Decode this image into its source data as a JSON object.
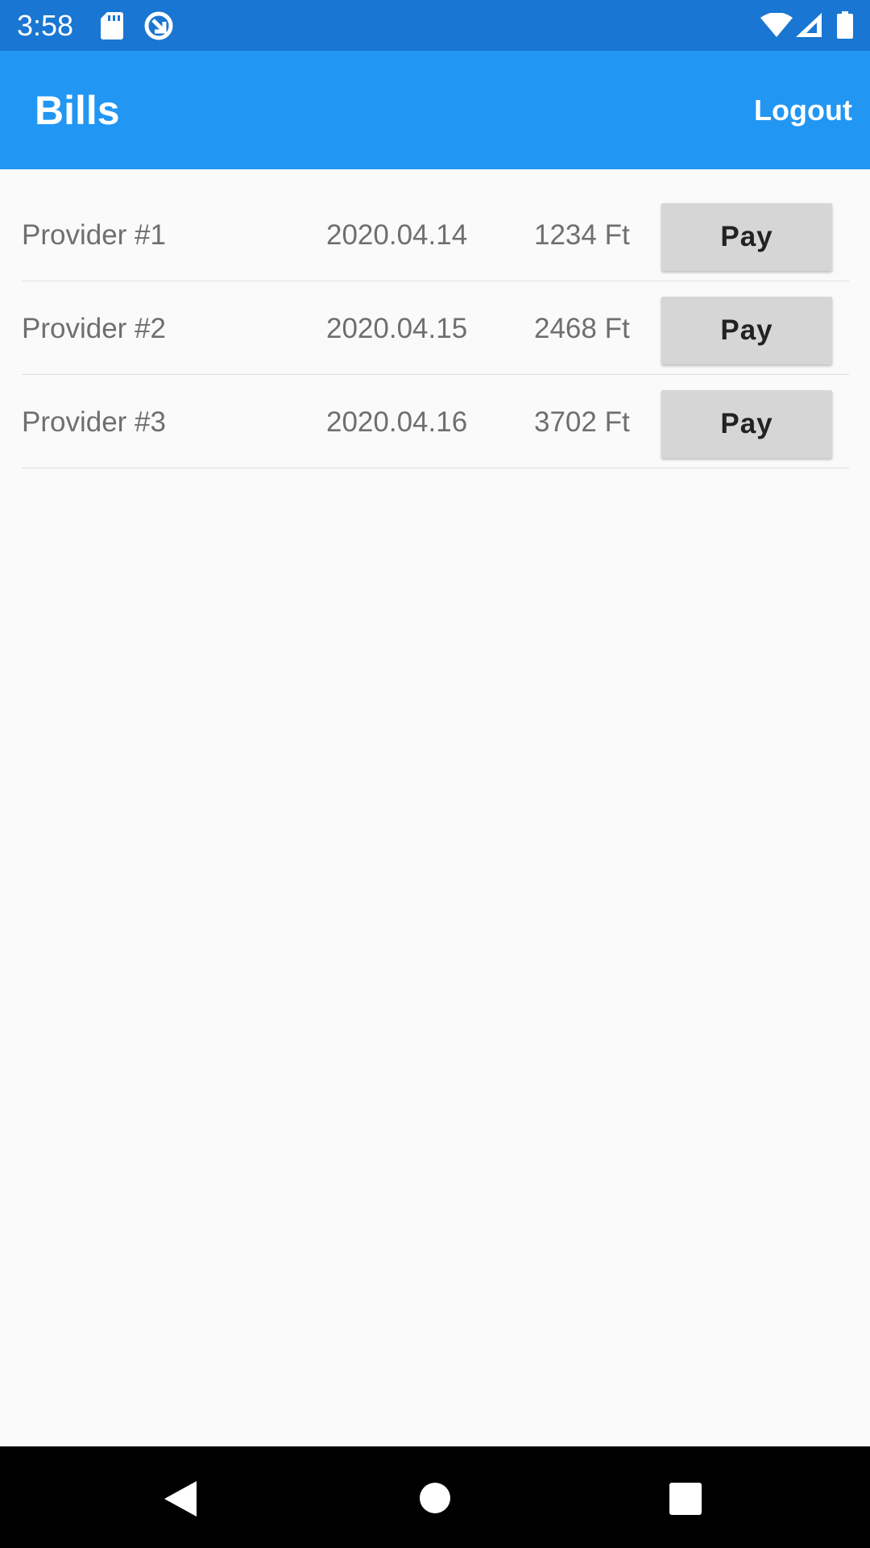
{
  "status_bar": {
    "time": "3:58",
    "left_icons": [
      "sd-card-icon",
      "data-saver-icon"
    ],
    "right_icons": [
      "wifi-icon",
      "cell-signal-icon",
      "battery-icon"
    ]
  },
  "app_bar": {
    "title": "Bills",
    "logout_label": "Logout",
    "color": "#2196f3"
  },
  "bills": [
    {
      "provider": "Provider #1",
      "date": "2020.04.14",
      "amount": "1234 Ft",
      "action": "Pay"
    },
    {
      "provider": "Provider #2",
      "date": "2020.04.15",
      "amount": "2468 Ft",
      "action": "Pay"
    },
    {
      "provider": "Provider #3",
      "date": "2020.04.16",
      "amount": "3702 Ft",
      "action": "Pay"
    }
  ],
  "nav_bar": {
    "icons": [
      "back-icon",
      "home-icon",
      "recents-icon"
    ]
  }
}
